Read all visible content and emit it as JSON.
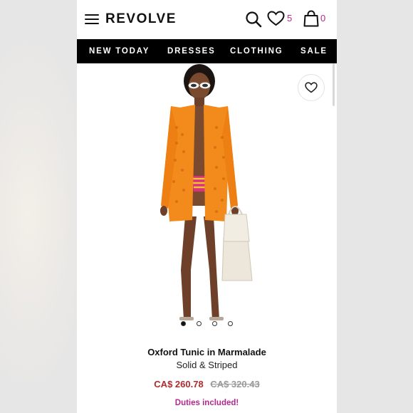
{
  "header": {
    "logo": "REVOLVE",
    "wishlist_count": "5",
    "cart_count": "0"
  },
  "nav": {
    "items": [
      {
        "label": "NEW TODAY"
      },
      {
        "label": "DRESSES"
      },
      {
        "label": "CLOTHING"
      },
      {
        "label": "SALE"
      }
    ]
  },
  "gallery": {
    "slide_count": 4,
    "active_slide": 1
  },
  "product": {
    "title": "Oxford Tunic in Marmalade",
    "brand": "Solid & Striped",
    "sale_price": "CA$ 260.78",
    "original_price": "CA$ 320.43",
    "duties_note": "Duties included!"
  },
  "colors": {
    "accent": "#b3288e",
    "sale": "#b02b2b",
    "nav_bg": "#000000"
  }
}
